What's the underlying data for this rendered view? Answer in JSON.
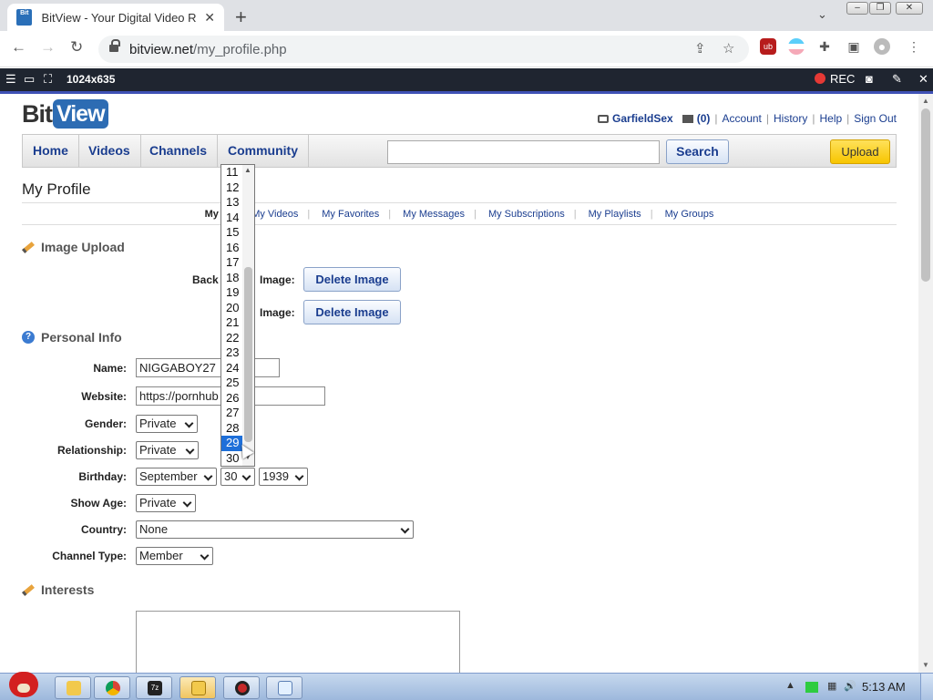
{
  "browser": {
    "tab_title": "BitView - Your Digital Video Re",
    "tab_favicon": "Bit",
    "url_host": "bitview.net",
    "url_path": "/my_profile.php"
  },
  "recbar": {
    "resolution": "1024x635",
    "rec_label": "REC"
  },
  "site": {
    "logo_bit": "Bit",
    "logo_view": "View",
    "user": {
      "name": "GarfieldSex",
      "mail_count": "(0)",
      "links": [
        "Account",
        "History",
        "Help",
        "Sign Out"
      ]
    },
    "nav": [
      "Home",
      "Videos",
      "Channels",
      "Community"
    ],
    "search_label": "Search",
    "upload_label": "Upload"
  },
  "page": {
    "title": "My Profile",
    "subnav_current": "My P",
    "subnav": [
      "My Videos",
      "My Favorites",
      "My Messages",
      "My Subscriptions",
      "My Playlists",
      "My Groups"
    ],
    "image_upload": {
      "heading": "Image Upload",
      "rows": [
        {
          "label_left": "Back",
          "label_right": "Image:",
          "button": "Delete Image"
        },
        {
          "label_right": "Image:",
          "button": "Delete Image"
        }
      ]
    },
    "personal_info": {
      "heading": "Personal Info",
      "name_label": "Name:",
      "name_value": "NIGGABOY27",
      "website_label": "Website:",
      "website_value": "https://pornhub",
      "gender_label": "Gender:",
      "gender_value": "Private",
      "relationship_label": "Relationship:",
      "relationship_value": "Private",
      "birthday_label": "Birthday:",
      "birthday_month": "September",
      "birthday_day": "30",
      "birthday_year": "1939",
      "show_age_label": "Show Age:",
      "show_age_value": "Private",
      "country_label": "Country:",
      "country_value": "None",
      "channel_type_label": "Channel Type:",
      "channel_type_value": "Member"
    },
    "interests": {
      "heading": "Interests"
    },
    "day_dropdown": {
      "options": [
        "11",
        "12",
        "13",
        "14",
        "15",
        "16",
        "17",
        "18",
        "19",
        "20",
        "21",
        "22",
        "23",
        "24",
        "25",
        "26",
        "27",
        "28",
        "29",
        "30"
      ],
      "highlighted": "29"
    }
  },
  "taskbar": {
    "clock": "5:13 AM"
  }
}
